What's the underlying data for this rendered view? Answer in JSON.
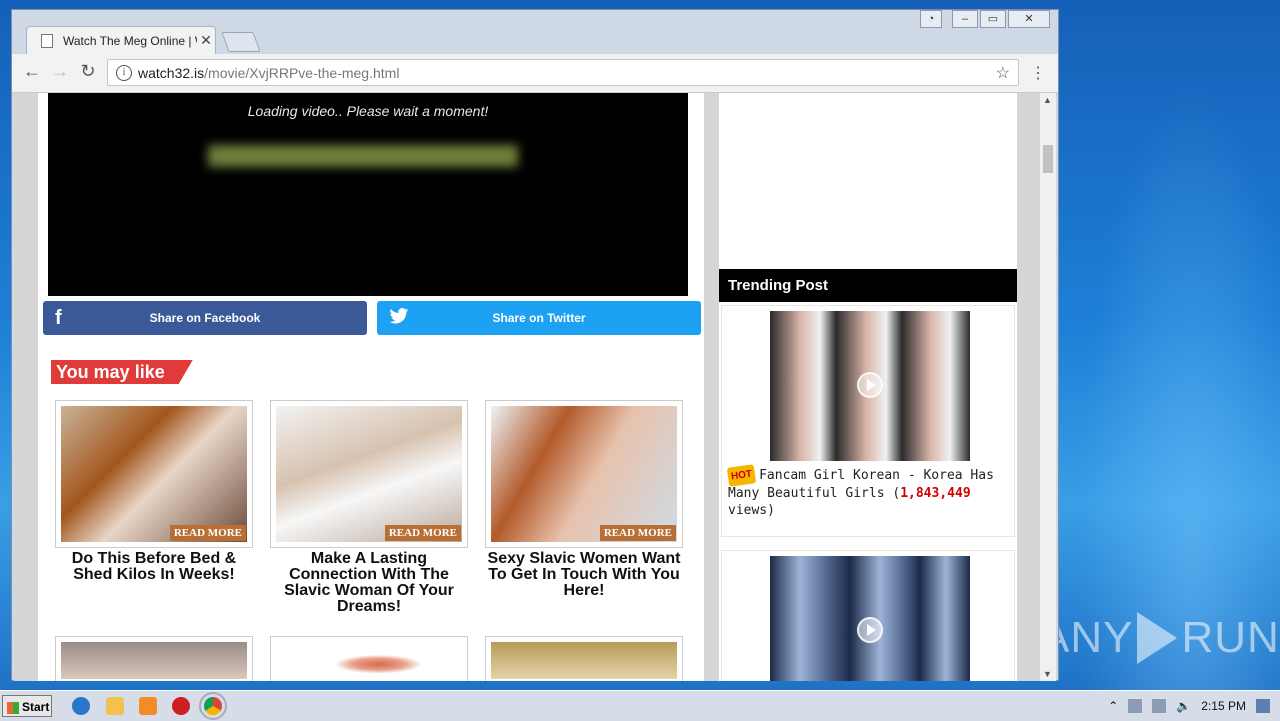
{
  "browser": {
    "tab_title": "Watch The Meg Online | Wa",
    "url_host": "watch32.is",
    "url_path": "/movie/XvjRRPve-the-meg.html"
  },
  "player": {
    "loading_text": "Loading video.. Please wait a moment!"
  },
  "share": {
    "facebook_label": "Share on Facebook",
    "twitter_label": "Share on Twitter"
  },
  "you_may_like": {
    "heading": "You may like",
    "read_more": "READ MORE",
    "cards": [
      {
        "title": "Do This Before Bed & Shed Kilos In Weeks!"
      },
      {
        "title": "Make A Lasting Connection With The Slavic Woman Of Your Dreams!"
      },
      {
        "title": "Sexy Slavic Women Want To Get In Touch With You Here!"
      }
    ]
  },
  "sidebar": {
    "trending_heading": "Trending Post",
    "posts": [
      {
        "badge": "HOT",
        "title": "Fancam Girl Korean - Korea Has Many Beautiful Girls",
        "views": "1,843,449",
        "views_suffix": "views"
      }
    ]
  },
  "taskbar": {
    "start_label": "Start",
    "clock": "2:15 PM"
  },
  "watermark": {
    "left": "ANY",
    "right": "RUN"
  },
  "colors": {
    "facebook": "#3b5998",
    "twitter": "#1da1f2",
    "accent_red": "#e03a3a",
    "views_red": "#d00000"
  }
}
